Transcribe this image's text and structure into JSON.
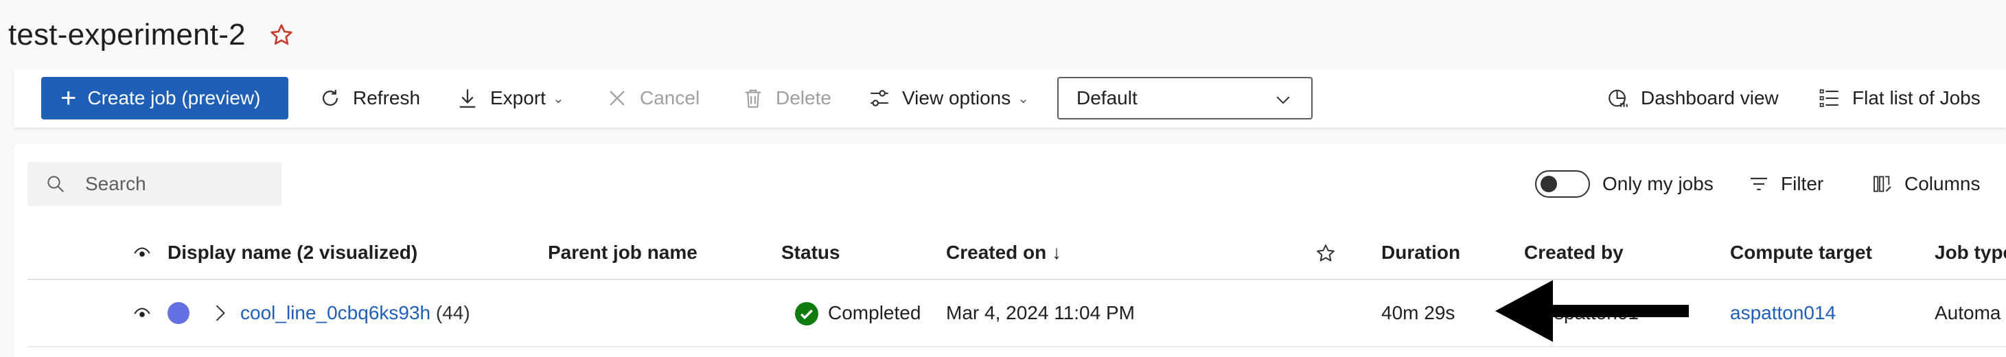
{
  "page": {
    "title": "test-experiment-2"
  },
  "toolbar": {
    "create_label": "Create job (preview)",
    "refresh_label": "Refresh",
    "export_label": "Export",
    "cancel_label": "Cancel",
    "delete_label": "Delete",
    "view_options_label": "View options",
    "view_select_value": "Default",
    "dashboard_label": "Dashboard view",
    "flat_list_label": "Flat list of Jobs"
  },
  "filters": {
    "search_placeholder": "Search",
    "only_my_jobs_label": "Only my jobs",
    "only_my_jobs_on": false,
    "filter_label": "Filter",
    "columns_label": "Columns"
  },
  "table": {
    "columns": {
      "display_name": "Display name (2 visualized)",
      "parent_job": "Parent job name",
      "status": "Status",
      "created_on": "Created on ↓",
      "duration": "Duration",
      "created_by": "Created by",
      "compute_target": "Compute target",
      "job_type": "Job type"
    },
    "rows": [
      {
        "name": "cool_line_0cbq6ks93h",
        "child_count": "(44)",
        "status": "Completed",
        "created_on": "Mar 4, 2024 11:04 PM",
        "duration": "40m 29s",
        "created_by": "spatton01",
        "compute_target": "aspatton014",
        "job_type": "Automa"
      }
    ]
  },
  "colors": {
    "primary": "#1f5fb5",
    "favorite_star": "#c43d30",
    "status_completed": "#107c10",
    "run_color_dot": "#6470e3",
    "annotation_arrow": "#000000"
  }
}
